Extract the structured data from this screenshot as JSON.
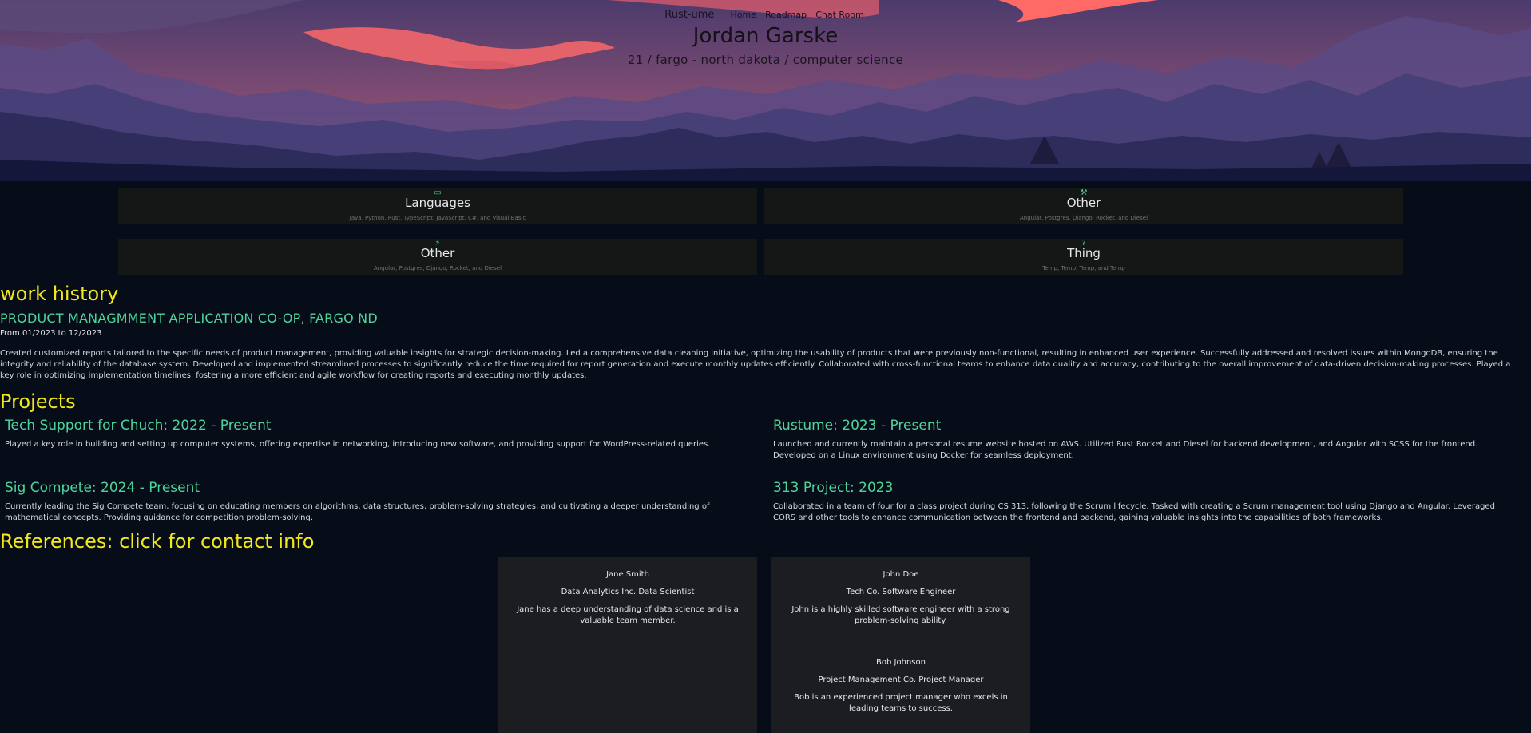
{
  "nav": {
    "brand": "Rust-ume",
    "links": [
      "Home",
      "Roadmap",
      "Chat Room"
    ]
  },
  "hero": {
    "name": "Jordan Garske",
    "subtitle": "21 / fargo - north dakota / computer science"
  },
  "skills": [
    {
      "icon": "laptop-icon",
      "glyph": "▭",
      "title": "Languages",
      "desc": "Java, Python, Rust, TypeScript, JavaScript, C#, and Visual Basic"
    },
    {
      "icon": "wrench-icon",
      "glyph": "⚒",
      "title": "Other",
      "desc": "Angular, Postgres, Django, Rocket, and Diesel"
    },
    {
      "icon": "lightning-icon",
      "glyph": "⚡",
      "title": "Other",
      "desc": "Angular, Postgres, Django, Rocket, and Diesel"
    },
    {
      "icon": "question-icon",
      "glyph": "?",
      "title": "Thing",
      "desc": "Temp, Temp, Temp, and Temp"
    }
  ],
  "work_history": {
    "heading": "work history",
    "jobs": [
      {
        "title": "PRODUCT MANAGMMENT APPLICATION CO-OP, FARGO ND",
        "dates": "From 01/2023 to 12/2023",
        "description": "Created customized reports tailored to the specific needs of product management, providing valuable insights for strategic decision-making. Led a comprehensive data cleaning initiative, optimizing the usability of products that were previously non-functional, resulting in enhanced user experience. Successfully addressed and resolved issues within MongoDB, ensuring the integrity and reliability of the database system. Developed and implemented streamlined processes to significantly reduce the time required for report generation and execute monthly updates efficiently. Collaborated with cross-functional teams to enhance data quality and accuracy, contributing to the overall improvement of data-driven decision-making processes. Played a key role in optimizing implementation timelines, fostering a more efficient and agile workflow for creating reports and executing monthly updates."
      }
    ]
  },
  "projects": {
    "heading": "Projects",
    "items": [
      {
        "title": "Tech Support for Chuch: 2022 - Present",
        "description": "Played a key role in building and setting up computer systems, offering expertise in networking, introducing new software, and providing support for WordPress-related queries."
      },
      {
        "title": "Rustume: 2023 - Present",
        "description": "Launched and currently maintain a personal resume website hosted on AWS. Utilized Rust Rocket and Diesel for backend development, and Angular with SCSS for the frontend. Developed on a Linux environment using Docker for seamless deployment."
      },
      {
        "title": "Sig Compete: 2024 - Present",
        "description": "Currently leading the Sig Compete team, focusing on educating members on algorithms, data structures, problem-solving strategies, and cultivating a deeper understanding of mathematical concepts. Providing guidance for competition problem-solving."
      },
      {
        "title": "313 Project: 2023",
        "description": "Collaborated in a team of four for a class project during CS 313, following the Scrum lifecycle. Tasked with creating a Scrum management tool using Django and Angular. Leveraged CORS and other tools to enhance communication between the frontend and backend, gaining valuable insights into the capabilities of both frameworks."
      }
    ]
  },
  "references": {
    "heading": "References: click for contact info",
    "items": [
      {
        "name": "Jane Smith",
        "role": "Data Analytics Inc. Data Scientist",
        "description": "Jane has a deep understanding of data science and is a valuable team member."
      },
      {
        "name": "John Doe",
        "role": "Tech Co. Software Engineer",
        "description": "John is a highly skilled software engineer with a strong problem-solving ability."
      },
      {
        "name": "Bob Johnson",
        "role": "Project Management Co. Project Manager",
        "description": "Bob is an experienced project manager who excels in leading teams to success."
      }
    ]
  }
}
